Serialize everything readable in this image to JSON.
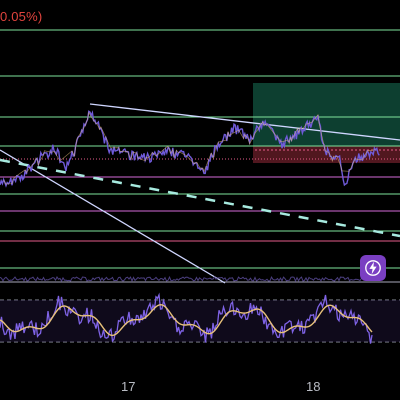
{
  "header": {
    "change_text": "0.05%)"
  },
  "chart_data": {
    "type": "line",
    "x_ticks": [
      "17",
      "18"
    ],
    "price_series_color": "#6f5ad9",
    "ma_color": "#e8c27a",
    "oscillator_color": "#7f63e6",
    "grid": false,
    "icon": "lightning-alert-icon",
    "colors": {
      "background": "#000000",
      "horizontal_green": "#7ee39c",
      "horizontal_pink": "#e35d8a",
      "horizontal_magenta": "#d56ad8",
      "trendline_white": "#cfd6ff",
      "dashed_teal": "#a7eadf",
      "long_box_fill": "#0f4a38",
      "short_box_fill": "#5a1a22"
    }
  },
  "footer": {
    "tick_17": "17",
    "tick_18": "18"
  }
}
